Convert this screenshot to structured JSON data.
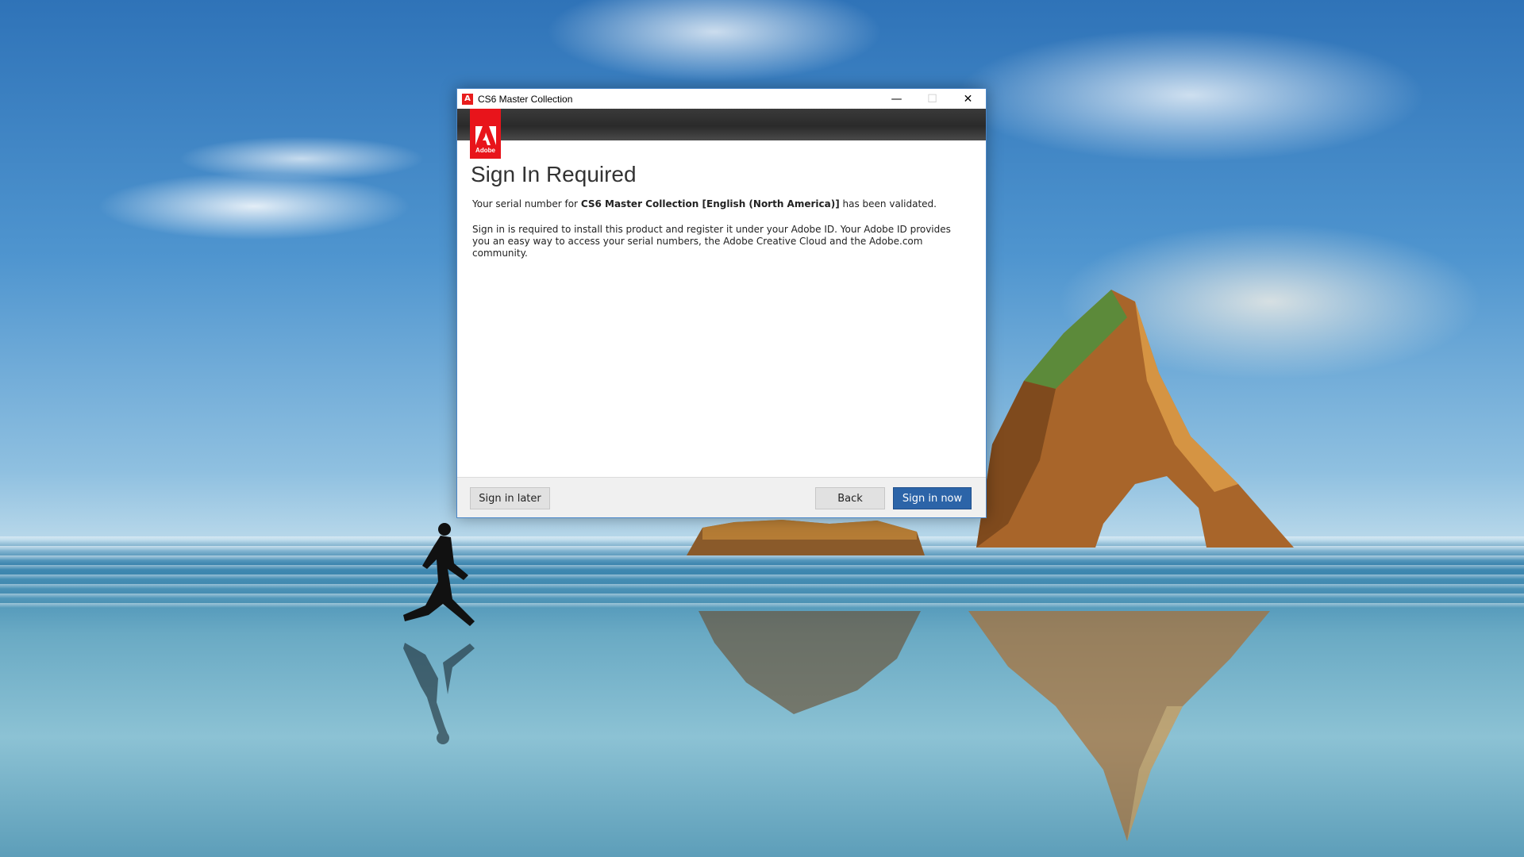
{
  "window": {
    "title": "CS6 Master Collection",
    "app_icon_glyph": "A",
    "controls": {
      "minimize_glyph": "—",
      "maximize_glyph": "☐",
      "close_glyph": "✕"
    }
  },
  "logo": {
    "word": "Adobe",
    "color": "#e8141b"
  },
  "content": {
    "heading": "Sign In Required",
    "serial_prefix": "Your serial number for ",
    "serial_product": "CS6 Master Collection [English (North America)]",
    "serial_suffix": " has been validated.",
    "paragraph2": "Sign in is required to install this product and register it under your Adobe ID. Your Adobe ID provides you an easy way to access your serial numbers, the Adobe Creative Cloud and the Adobe.com community."
  },
  "footer": {
    "sign_in_later_label": "Sign in later",
    "back_label": "Back",
    "sign_in_now_label": "Sign in now",
    "primary_color": "#2c64a8"
  }
}
